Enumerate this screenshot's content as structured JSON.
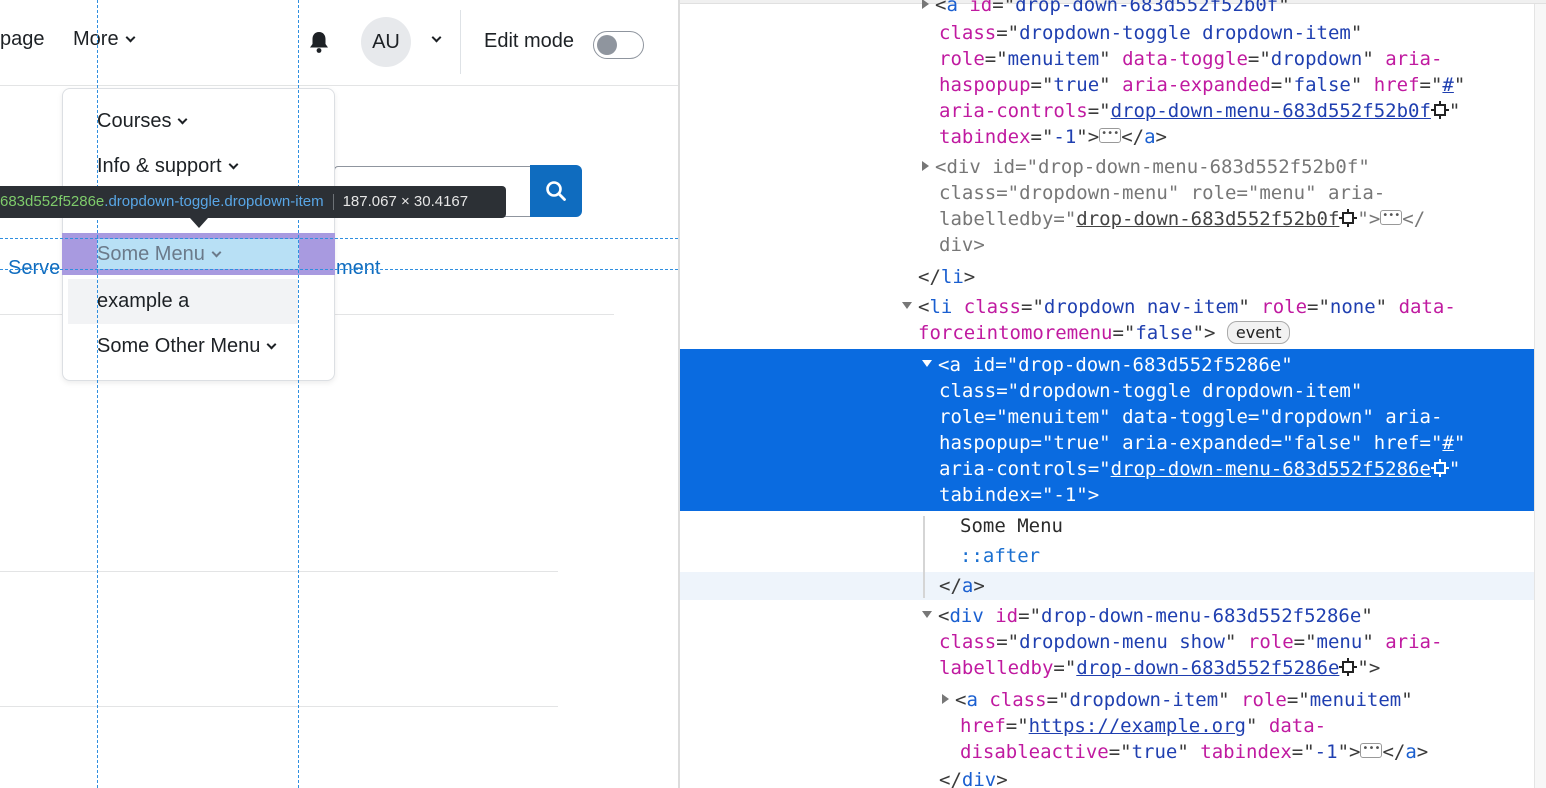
{
  "page": {
    "nav": {
      "page_link": "page",
      "more_link": "More",
      "avatar_initials": "AU",
      "edit_mode_label": "Edit mode",
      "edit_mode_on": false
    },
    "dropdown": {
      "items": [
        "Courses",
        "Info & support",
        "Some Menu",
        "example a",
        "Some Other Menu"
      ]
    },
    "links": {
      "left": "Serve",
      "right": "ment"
    },
    "tooltip": {
      "id_part": "683d552f5286e",
      "class_part": ".dropdown-toggle.dropdown-item",
      "size": "187.067 × 30.4167"
    },
    "icons": {
      "notifications": "bell-icon",
      "search": "search-icon",
      "chevron": "chevron-down-icon"
    },
    "colors": {
      "primary": "#0f6cbf",
      "selection": "#0a6be0",
      "highlight_margin": "#a89ae0",
      "highlight_content": "#b8e0f5"
    }
  },
  "inspector": {
    "l1": {
      "tag": "a",
      "attr": "id",
      "val": "drop-down-683d552f52b0f"
    },
    "l2": {
      "attr1": "class",
      "val1": "dropdown-toggle dropdown-item"
    },
    "l3": {
      "attr1": "role",
      "val1": "menuitem",
      "attr2": "data-toggle",
      "val2": "dropdown",
      "attr3": "aria-"
    },
    "l4": {
      "attr1": "haspopup",
      "val1": "true",
      "attr2": "aria-expanded",
      "val2": "false",
      "attr3": "href",
      "val3": "#"
    },
    "l5": {
      "attr1": "aria-controls",
      "val1": "drop-down-menu-683d552f52b0f"
    },
    "l6": {
      "attr1": "tabindex",
      "val1": "-1",
      "close": "a"
    },
    "l7": {
      "tag": "div",
      "attr1": "id",
      "val1": "drop-down-menu-683d552f52b0f"
    },
    "l8": {
      "attr1": "class",
      "val1": "dropdown-menu",
      "attr2": "role",
      "val2": "menu",
      "attr3": "aria-"
    },
    "l9": {
      "attr1": "labelledby",
      "val1": "drop-down-683d552f52b0f"
    },
    "l10": {
      "text": "div"
    },
    "l11": {
      "text": "li"
    },
    "l12": {
      "tag": "li",
      "attr1": "class",
      "val1": "dropdown nav-item",
      "attr2": "role",
      "val2": "none",
      "attr3": "data-"
    },
    "l13": {
      "attr1": "forceintomoremenu",
      "val1": "false",
      "badge": "event"
    },
    "s1": {
      "tag": "a",
      "attr1": "id",
      "val1": "drop-down-683d552f5286e"
    },
    "s2": {
      "attr1": "class",
      "val1": "dropdown-toggle dropdown-item"
    },
    "s3": {
      "attr1": "role",
      "val1": "menuitem",
      "attr2": "data-toggle",
      "val2": "dropdown",
      "attr3": "aria-"
    },
    "s4": {
      "attr1": "haspopup",
      "val1": "true",
      "attr2": "aria-expanded",
      "val2": "false",
      "attr3": "href",
      "val3": "#"
    },
    "s5": {
      "attr1": "aria-controls",
      "val1": "drop-down-menu-683d552f5286e"
    },
    "s6": {
      "attr1": "tabindex",
      "val1": "-1"
    },
    "c1": {
      "text": "Some Menu"
    },
    "c2": {
      "text": "::after"
    },
    "c3": {
      "text": "a"
    },
    "d1": {
      "tag": "div",
      "attr1": "id",
      "val1": "drop-down-menu-683d552f5286e"
    },
    "d2": {
      "attr1": "class",
      "val1": "dropdown-menu show",
      "attr2": "role",
      "val2": "menu",
      "attr3": "aria-"
    },
    "d3": {
      "attr1": "labelledby",
      "val1": "drop-down-683d552f5286e"
    },
    "e1": {
      "tag": "a",
      "attr1": "class",
      "val1": "dropdown-item",
      "attr2": "role",
      "val2": "menuitem"
    },
    "e2": {
      "attr1": "href",
      "val1": "https://example.org",
      "attr2": "data-"
    },
    "e3": {
      "attr1": "disableactive",
      "val1": "true",
      "attr2": "tabindex",
      "val2": "-1",
      "close": "a"
    },
    "e4": {
      "text": "div"
    }
  }
}
